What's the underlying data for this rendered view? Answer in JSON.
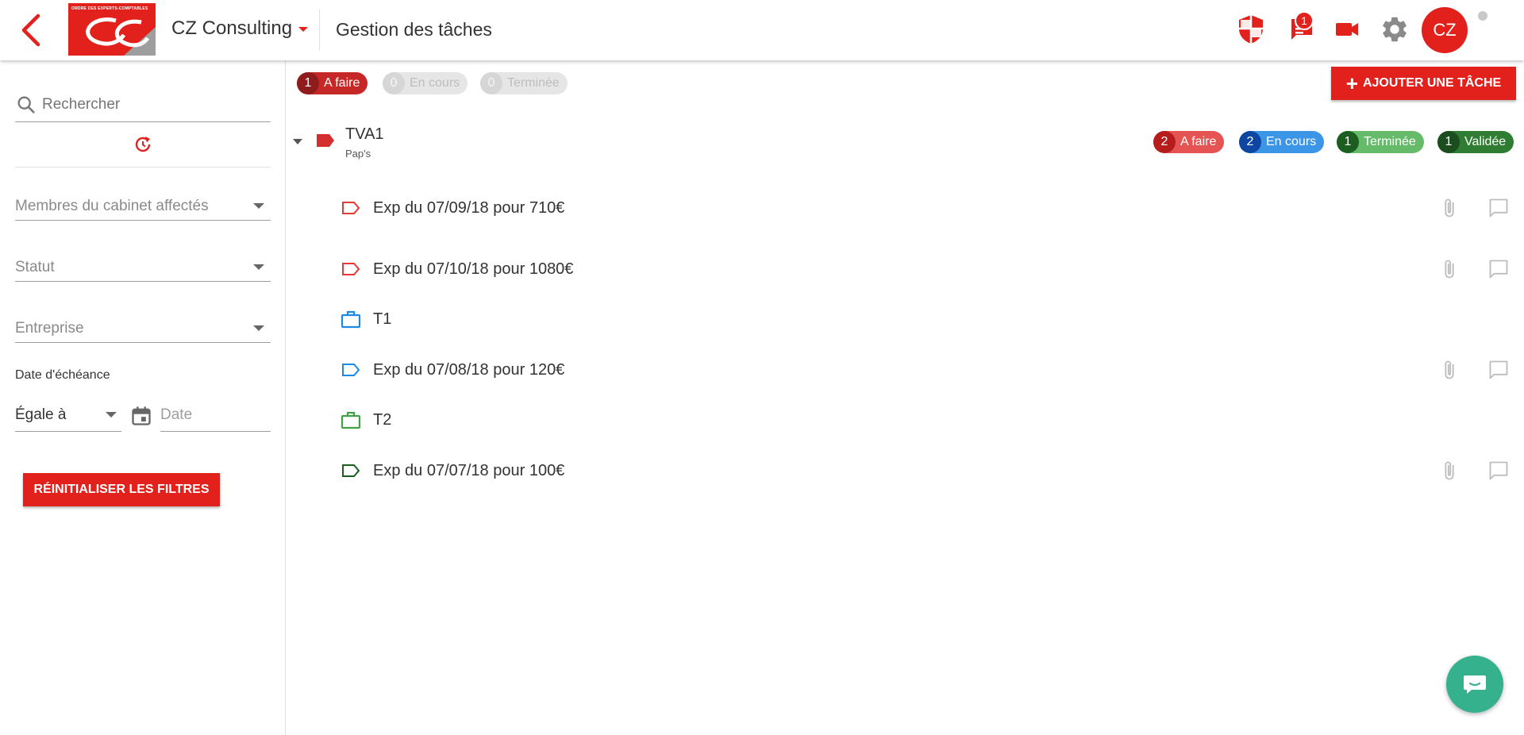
{
  "header": {
    "company_name": "CZ Consulting",
    "page_title": "Gestion des tâches",
    "logo_text": "ORDRE DES EXPERTS-COMPTABLES",
    "notification_count": "1",
    "avatar_initials": "CZ",
    "icons": [
      "back-arrow-icon",
      "shield-icon",
      "chat-icon",
      "video-camera-icon",
      "gear-icon"
    ]
  },
  "sidebar": {
    "search_placeholder": "Rechercher",
    "filters": {
      "members": "Membres du cabinet affectés",
      "status": "Statut",
      "company": "Entreprise"
    },
    "due_date_label": "Date d'échéance",
    "comparator_value": "Égale à",
    "date_placeholder": "Date",
    "reset_label": "RÉINITIALISER LES FILTRES"
  },
  "main": {
    "summary_pills": [
      {
        "count": "1",
        "label": "A faire"
      },
      {
        "count": "0",
        "label": "En cours"
      },
      {
        "count": "0",
        "label": "Terminée"
      }
    ],
    "add_task_label": "AJOUTER UNE TÂCHE",
    "group": {
      "title": "TVA1",
      "subtitle": "Pap's",
      "status_pills": [
        {
          "count": "2",
          "label": "A faire"
        },
        {
          "count": "2",
          "label": "En cours"
        },
        {
          "count": "1",
          "label": "Terminée"
        },
        {
          "count": "1",
          "label": "Validée"
        }
      ]
    },
    "tasks": [
      {
        "label": "Exp du 07/09/18 pour 710€",
        "icon": "tag-outline-icon",
        "color": "#e53935"
      },
      {
        "label": "Exp du 07/10/18 pour 1080€",
        "icon": "tag-outline-icon",
        "color": "#e53935"
      },
      {
        "label": "T1",
        "icon": "briefcase-icon",
        "color": "#1e88e5"
      },
      {
        "label": "Exp du 07/08/18 pour 120€",
        "icon": "tag-outline-icon",
        "color": "#1e88e5"
      },
      {
        "label": "T2",
        "icon": "briefcase-icon",
        "color": "#43a047"
      },
      {
        "label": "Exp du 07/07/18 pour 100€",
        "icon": "tag-outline-icon",
        "color": "#1b5e20"
      }
    ]
  },
  "colors": {
    "brand_red": "#e2211c",
    "todo_red": "#e55353",
    "in_progress_blue": "#3c96e8",
    "done_green": "#66bb6a",
    "validated_green": "#2e7d32",
    "fab_teal": "#35b18e"
  }
}
